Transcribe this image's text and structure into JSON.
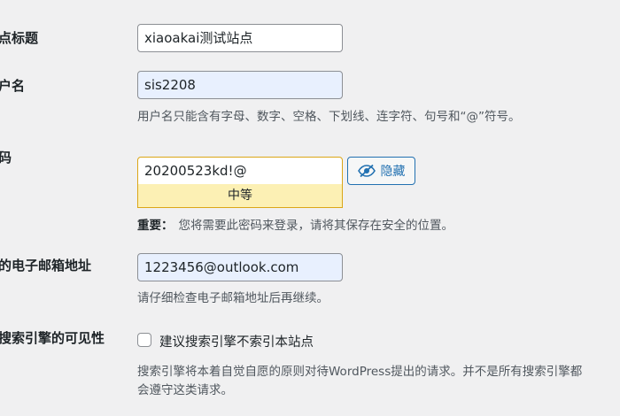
{
  "site_title": {
    "label": "点标题",
    "value": "xiaoakai测试站点"
  },
  "username": {
    "label": "户名",
    "value": "sis2208",
    "description": "用户名只能含有字母、数字、空格、下划线、连字符、句号和“@”符号。"
  },
  "password": {
    "label": "码",
    "value": "20200523kd!@",
    "hide_button_label": "隐藏",
    "strength_label": "中等",
    "important_prefix": "重要：",
    "important_text": "您将需要此密码来登录，请将其保存在安全的位置。"
  },
  "email": {
    "label": "的电子邮箱地址",
    "value": "1223456@outlook.com",
    "description": "请仔细检查电子邮箱地址后再继续。"
  },
  "search_visibility": {
    "label": "搜索引擎的可见性",
    "checkbox_label": "建议搜索引擎不索引本站点",
    "checked": false,
    "description_line1": "搜索引擎将本着自觉自愿的原则对待WordPress提出的请求。并不是所有搜索引擎都",
    "description_line2": "会遵守这类请求。"
  },
  "colors": {
    "accent": "#2271b1",
    "warning_border": "#dba617",
    "strength_bg": "#fcf0b4",
    "autofill_bg": "#e8f0fe",
    "page_bg": "#f0f0f1"
  }
}
